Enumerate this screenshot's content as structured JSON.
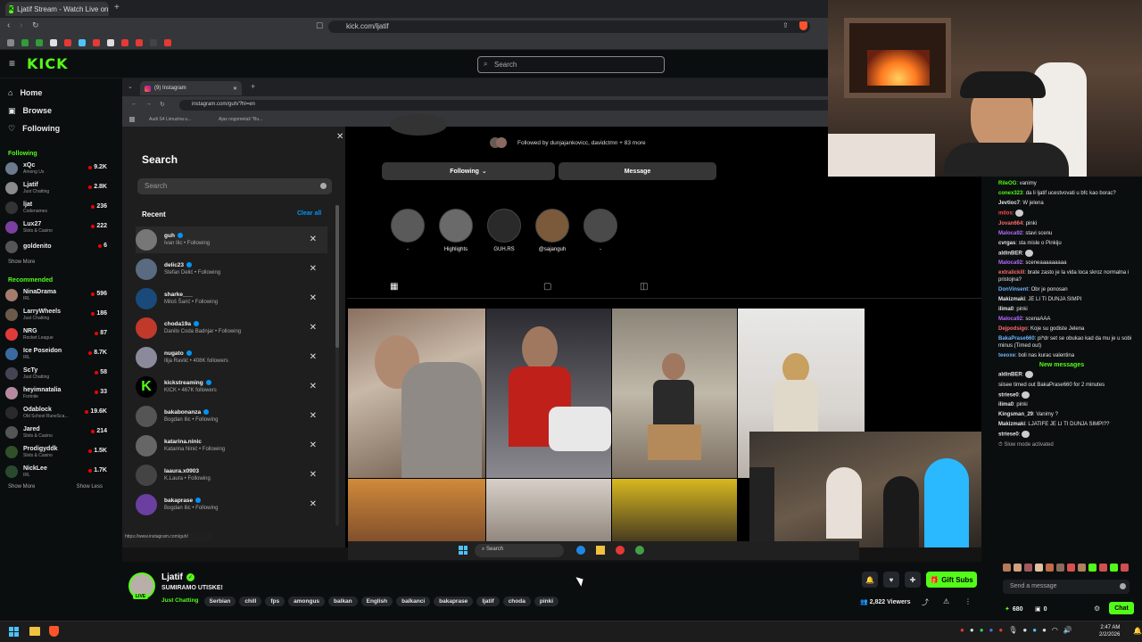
{
  "browser": {
    "tab_title": "Ljatif Stream - Watch Live on",
    "url": "kick.com/ljatif"
  },
  "kick": {
    "logo": "KICK",
    "search_placeholder": "Search",
    "nav": [
      {
        "label": "Home"
      },
      {
        "label": "Browse"
      },
      {
        "label": "Following"
      }
    ],
    "following_header": "Following",
    "following": [
      {
        "name": "xQc",
        "game": "Among Us",
        "viewers": "9.2K",
        "color": "#6b7a8f"
      },
      {
        "name": "Ljatif",
        "game": "Just Chatting",
        "viewers": "2.8K",
        "color": "#8a8a8a"
      },
      {
        "name": "ljat",
        "game": "Codenames",
        "viewers": "236",
        "color": "#333"
      },
      {
        "name": "Lux27",
        "game": "Slots & Casino",
        "viewers": "222",
        "color": "#7a3fa0"
      },
      {
        "name": "goldenito",
        "game": "",
        "viewers": "6",
        "color": "#555"
      }
    ],
    "show_more": "Show More",
    "recommended_header": "Recommended",
    "recommended": [
      {
        "name": "NinaDrama",
        "game": "IRL",
        "viewers": "596",
        "color": "#a67c6d"
      },
      {
        "name": "LarryWheels",
        "game": "Just Chatting",
        "viewers": "186",
        "color": "#6a5a4a"
      },
      {
        "name": "NRG",
        "game": "Rocket League",
        "viewers": "87",
        "color": "#e23a3a"
      },
      {
        "name": "Ice Poseidon",
        "game": "IRL",
        "viewers": "8.7K",
        "color": "#3a6aa0"
      },
      {
        "name": "ScTy",
        "game": "Just Chatting",
        "viewers": "58",
        "color": "#445"
      },
      {
        "name": "heyimnatalia",
        "game": "Fortnite",
        "viewers": "33",
        "color": "#b58aa0"
      },
      {
        "name": "Odablock",
        "game": "Old School RuneSca...",
        "viewers": "19.6K",
        "color": "#2a2a2a"
      },
      {
        "name": "Jared",
        "game": "Slots & Casino",
        "viewers": "214",
        "color": "#555"
      },
      {
        "name": "Prodigyddk",
        "game": "Slots & Casino",
        "viewers": "1.5K",
        "color": "#30502a"
      },
      {
        "name": "NickLee",
        "game": "IRL",
        "viewers": "1.7K",
        "color": "#2a4a30"
      }
    ],
    "show_more2": "Show More",
    "show_less": "Show Less"
  },
  "instagram": {
    "tab_title": "(9) Instagram",
    "url": "instagram.com/guh/?hl=en",
    "bookmarks": [
      "Audi S4 Limuzina u...",
      "Ajax nogometaš \"Bu..."
    ],
    "search_title": "Search",
    "search_placeholder": "Search",
    "recent_label": "Recent",
    "clear_all": "Clear all",
    "recent": [
      {
        "username": "guh",
        "sub": "Ivan Ilic • Following",
        "verified": true,
        "color": "#777"
      },
      {
        "username": "delic23",
        "sub": "Stefan Delić • Following",
        "verified": true,
        "color": "#5a6a80"
      },
      {
        "username": "sharke___",
        "sub": "Miloš Šarić • Following",
        "verified": false,
        "color": "#1a4a7a"
      },
      {
        "username": "choda19a",
        "sub": "Danilo Coda Badnjar • Following",
        "verified": true,
        "color": "#c0392b"
      },
      {
        "username": "nugato",
        "sub": "Ilija Ravlić • 408K followers",
        "verified": true,
        "color": "#8a8a9a"
      },
      {
        "username": "kickstreaming",
        "sub": "KICK • 467K followers",
        "verified": true,
        "color": "#000"
      },
      {
        "username": "bakabonanza",
        "sub": "Bogdan Ilic • Following",
        "verified": true,
        "color": "#555"
      },
      {
        "username": "katarina.ninic",
        "sub": "Katarina Ninić • Following",
        "verified": false,
        "color": "#666"
      },
      {
        "username": "laaura.x0903",
        "sub": "K.Laura • Following",
        "verified": false,
        "color": "#444"
      },
      {
        "username": "bakaprase",
        "sub": "Bogdan Ilic • Following",
        "verified": true,
        "color": "#6a3fa0"
      }
    ],
    "followed_by": "Followed by dunjajankovicc, davidctmn + 83 more",
    "following_btn": "Following",
    "message_btn": "Message",
    "highlights": [
      {
        "label": "-"
      },
      {
        "label": "Highlights"
      },
      {
        "label": "GUH.RS"
      },
      {
        "label": "@sajanguh"
      },
      {
        "label": "-"
      }
    ],
    "status_url": "https://www.instagram.com/guh/",
    "taskbar_search": "Search"
  },
  "chat": {
    "messages": [
      {
        "user": "RileOG",
        "text": "vanimy",
        "color": "#53fc18"
      },
      {
        "user": "conex323",
        "text": "da li ljatif ucestvovati u bfc kao borac?",
        "color": "#53fc18"
      },
      {
        "user": "Jevtioc7",
        "text": "W jelena",
        "color": "#e6e6e6"
      },
      {
        "user": "milos",
        "text": "",
        "color": "#ff4a4a"
      },
      {
        "user": "Jovan664",
        "text": "pinki",
        "color": "#ff6b6b"
      },
      {
        "user": "Maloca92",
        "text": "stavi scenu",
        "color": "#b46bff"
      },
      {
        "user": "cvrgas",
        "text": "sta misle o Pinkiju",
        "color": "#e6e6e6"
      },
      {
        "user": "aldinBER",
        "text": "",
        "color": "#e6e6e6"
      },
      {
        "user": "Maloca92",
        "text": "sceneaaaaaaaaa",
        "color": "#b46bff"
      },
      {
        "user": "extralickill",
        "text": "brate zasto je la vida loca skroz normalna i pristojna?",
        "color": "#ff6b6b"
      },
      {
        "user": "DonVinsent",
        "text": "Obr je ponosan",
        "color": "#6bb4ff"
      },
      {
        "user": "Makizmaki",
        "text": "JE LI TI DUNJA SIMPI",
        "color": "#e6e6e6"
      },
      {
        "user": "ilima0",
        "text": "pinki",
        "color": "#e6e6e6"
      },
      {
        "user": "Maloca92",
        "text": "scenaAAA",
        "color": "#b46bff"
      },
      {
        "user": "Dejpodsigo",
        "text": "Koje su godiste Jelena",
        "color": "#ff6b6b"
      },
      {
        "user": "BakaPrase660",
        "text": "pi*dr set se obukao kad da mu je u sobi minus (Timed out)",
        "color": "#6bb4ff"
      },
      {
        "user": "teeoxe",
        "text": "boli nas kurac valentina",
        "color": "#6bb4ff"
      }
    ],
    "new_messages": "New messages",
    "messages2": [
      {
        "user": "aldinBER",
        "text": "",
        "color": "#e6e6e6"
      },
      {
        "user": "",
        "text": "siisee timed out BakaPrase660 for 2 minutes",
        "color": "#aaa"
      },
      {
        "user": "striese0",
        "text": "",
        "color": "#e6e6e6"
      },
      {
        "user": "ilima0",
        "text": "pinki",
        "color": "#e6e6e6"
      },
      {
        "user": "Kingsman_29",
        "text": "Vanimy ?",
        "color": "#e6e6e6"
      },
      {
        "user": "Makizmaki",
        "text": "LJATIFE JE LI TI DUNJA SIMPI??",
        "color": "#e6e6e6"
      },
      {
        "user": "striese0",
        "text": "",
        "color": "#e6e6e6"
      }
    ],
    "slow_mode": "Slow mode activated",
    "input_placeholder": "Send a message",
    "points": "680",
    "zero": "0",
    "chat_button": "Chat"
  },
  "stream": {
    "name": "Ljatif",
    "title": "SUMIRAMO UTISKE!",
    "category": "Just Chatting",
    "tags": [
      "Serbian",
      "chill",
      "fps",
      "amongus",
      "balkan",
      "English",
      "balkanci",
      "bakaprase",
      "ljatif",
      "choda",
      "pinki"
    ],
    "viewers": "2,822 Viewers",
    "gift_subs": "Gift Subs",
    "live_badge": "LIVE"
  },
  "taskbar": {
    "time": "2:47 AM",
    "date": "2/2/2026"
  },
  "colors": {
    "kick_green": "#53fc18",
    "bg": "#0b0e0f",
    "live_red": "#eb0400",
    "ig_blue": "#0095f6"
  }
}
